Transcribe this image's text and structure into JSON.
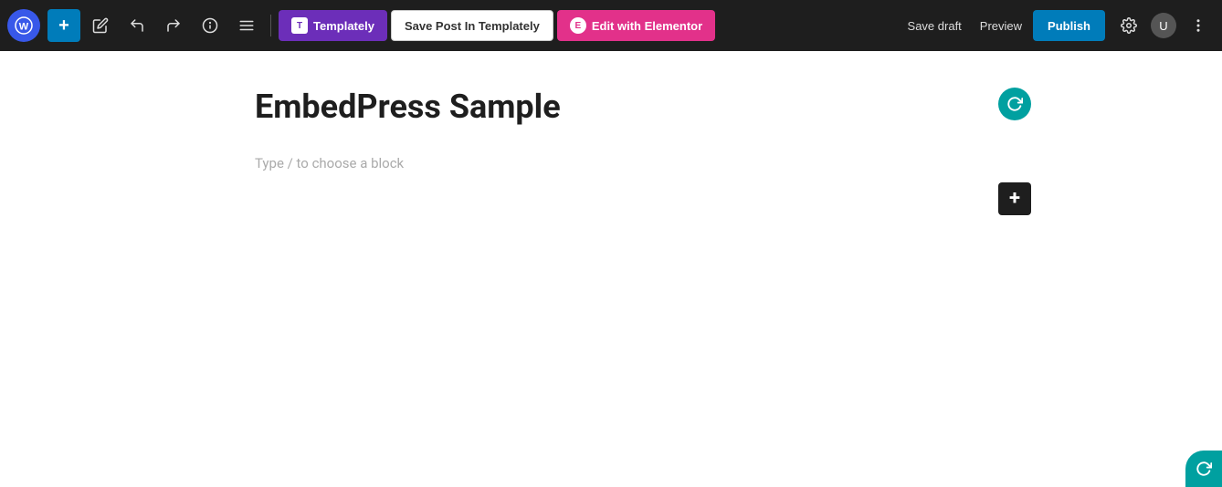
{
  "toolbar": {
    "wp_logo": "W",
    "add_block_icon": "+",
    "tools": [
      {
        "name": "edit-icon",
        "symbol": "✏",
        "label": "Edit"
      },
      {
        "name": "undo-icon",
        "symbol": "↩",
        "label": "Undo"
      },
      {
        "name": "redo-icon",
        "symbol": "↪",
        "label": "Redo"
      },
      {
        "name": "info-icon",
        "symbol": "ℹ",
        "label": "Info"
      },
      {
        "name": "tools-icon",
        "symbol": "≡",
        "label": "Tools"
      }
    ],
    "templately_label": "Templately",
    "save_templately_label": "Save Post In Templately",
    "elementor_label": "Edit with Elementor",
    "save_draft_label": "Save draft",
    "preview_label": "Preview",
    "publish_label": "Publish",
    "settings_icon": "⚙",
    "user_icon": "👤",
    "more_icon": "⋮"
  },
  "editor": {
    "post_title": "EmbedPress Sample",
    "block_placeholder": "Type / to choose a block"
  },
  "floating": {
    "refresh_icon": "↻",
    "add_icon": "+",
    "bottom_icon": "↻"
  }
}
